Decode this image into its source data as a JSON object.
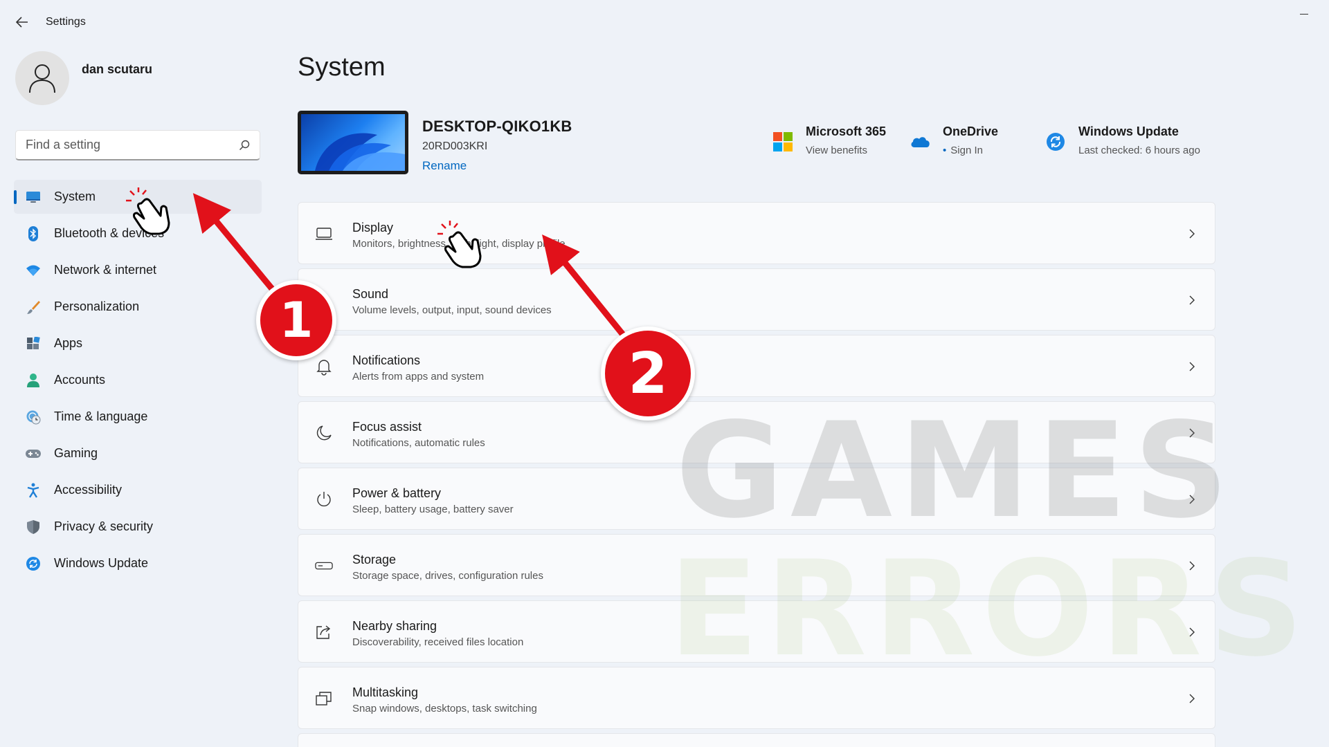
{
  "window": {
    "title": "Settings"
  },
  "user": {
    "name": "dan scutaru"
  },
  "search": {
    "placeholder": "Find a setting"
  },
  "sidebar": {
    "items": [
      {
        "label": "System",
        "icon": "system-display-icon",
        "active": true
      },
      {
        "label": "Bluetooth & devices",
        "icon": "bluetooth-icon"
      },
      {
        "label": "Network & internet",
        "icon": "wifi-icon"
      },
      {
        "label": "Personalization",
        "icon": "brush-icon"
      },
      {
        "label": "Apps",
        "icon": "apps-icon"
      },
      {
        "label": "Accounts",
        "icon": "accounts-icon"
      },
      {
        "label": "Time & language",
        "icon": "globe-clock-icon"
      },
      {
        "label": "Gaming",
        "icon": "gamepad-icon"
      },
      {
        "label": "Accessibility",
        "icon": "accessibility-icon"
      },
      {
        "label": "Privacy & security",
        "icon": "shield-icon"
      },
      {
        "label": "Windows Update",
        "icon": "update-icon"
      }
    ]
  },
  "main": {
    "title": "System",
    "device": {
      "name": "DESKTOP-QIKO1KB",
      "model": "20RD003KRI",
      "rename": "Rename"
    },
    "quick": [
      {
        "title": "Microsoft 365",
        "subtitle": "View benefits",
        "icon": "microsoft-logo-icon"
      },
      {
        "title": "OneDrive",
        "subtitle": "Sign In",
        "icon": "onedrive-cloud-icon"
      },
      {
        "title": "Windows Update",
        "subtitle": "Last checked: 6 hours ago",
        "icon": "windows-update-icon"
      }
    ],
    "cards": [
      {
        "title": "Display",
        "subtitle": "Monitors, brightness, night light, display profile",
        "icon": "display-icon"
      },
      {
        "title": "Sound",
        "subtitle": "Volume levels, output, input, sound devices",
        "icon": "speaker-icon"
      },
      {
        "title": "Notifications",
        "subtitle": "Alerts from apps and system",
        "icon": "bell-icon"
      },
      {
        "title": "Focus assist",
        "subtitle": "Notifications, automatic rules",
        "icon": "moon-icon"
      },
      {
        "title": "Power & battery",
        "subtitle": "Sleep, battery usage, battery saver",
        "icon": "power-icon"
      },
      {
        "title": "Storage",
        "subtitle": "Storage space, drives, configuration rules",
        "icon": "storage-drive-icon"
      },
      {
        "title": "Nearby sharing",
        "subtitle": "Discoverability, received files location",
        "icon": "share-icon"
      },
      {
        "title": "Multitasking",
        "subtitle": "Snap windows, desktops, task switching",
        "icon": "multitasking-icon"
      }
    ]
  },
  "watermark": {
    "line1": "GAMES",
    "line2": "ERRORS"
  },
  "annotations": {
    "badge1": "1",
    "badge2": "2"
  },
  "colors": {
    "accent": "#0067c0",
    "annotation_red": "#e1111a"
  }
}
